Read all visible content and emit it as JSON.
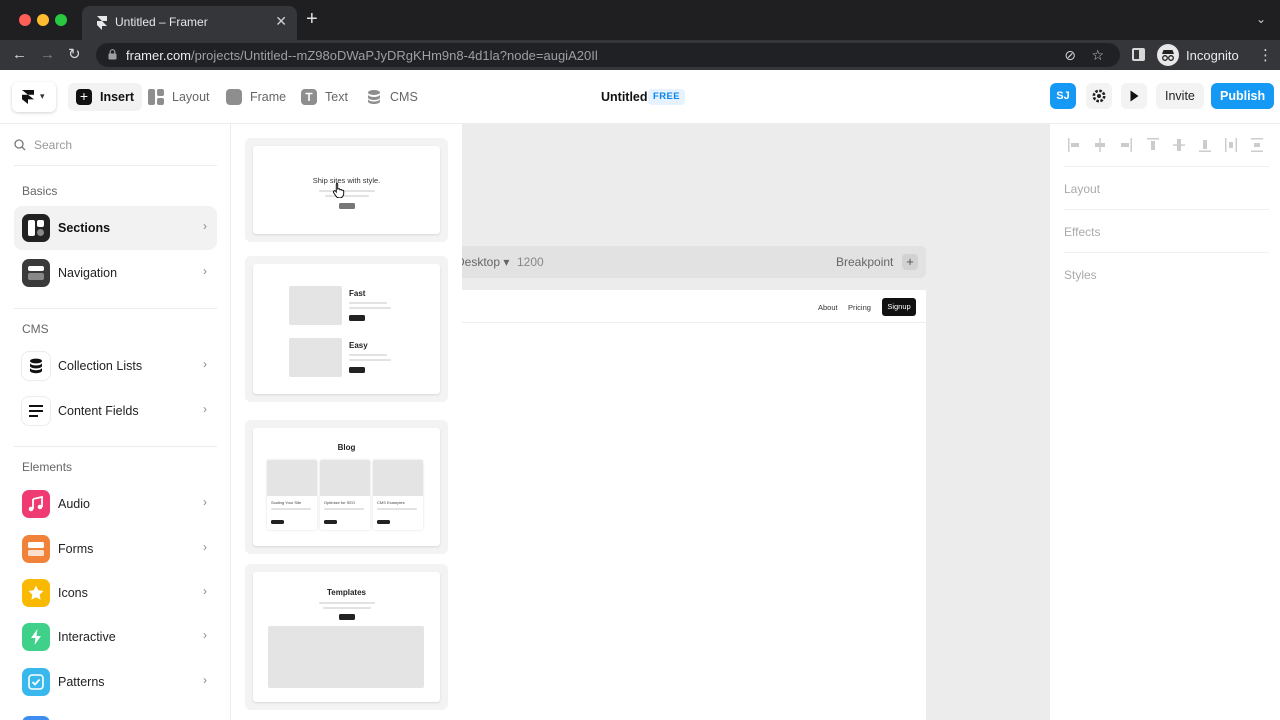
{
  "browser": {
    "tab_title": "Untitled – Framer",
    "url_domain": "framer.com",
    "url_path": "/projects/Untitled--mZ98oDWaPJyDRgKHm9n8-4d1la?node=augiA20Il",
    "profile_label": "Incognito"
  },
  "toolbar": {
    "insert": "Insert",
    "layout": "Layout",
    "frame": "Frame",
    "text": "Text",
    "cms": "CMS",
    "doc_title": "Untitled",
    "plan_badge": "FREE",
    "avatar_initials": "SJ",
    "invite": "Invite",
    "publish": "Publish"
  },
  "sidebar": {
    "search_placeholder": "Search",
    "groups": [
      {
        "title": "Basics",
        "items": [
          {
            "label": "Sections",
            "icon": "sections-icon",
            "color": "#222222"
          },
          {
            "label": "Navigation",
            "icon": "navigation-icon",
            "color": "#3a3a3a"
          }
        ]
      },
      {
        "title": "CMS",
        "items": [
          {
            "label": "Collection Lists",
            "icon": "database-icon",
            "color": "#ffffff"
          },
          {
            "label": "Content Fields",
            "icon": "lines-icon",
            "color": "#ffffff"
          }
        ]
      },
      {
        "title": "Elements",
        "items": [
          {
            "label": "Audio",
            "icon": "music-icon",
            "color": "#ef3a72"
          },
          {
            "label": "Forms",
            "icon": "form-icon",
            "color": "#f0823a"
          },
          {
            "label": "Icons",
            "icon": "star-icon",
            "color": "#f8b900"
          },
          {
            "label": "Interactive",
            "icon": "bolt-icon",
            "color": "#3fd18a"
          },
          {
            "label": "Patterns",
            "icon": "check-icon",
            "color": "#39b8ee"
          }
        ]
      }
    ]
  },
  "templates": {
    "hero": {
      "title": "Ship sites with style."
    },
    "features": {
      "items": [
        {
          "title": "Fast"
        },
        {
          "title": "Easy"
        }
      ]
    },
    "blog": {
      "title": "Blog",
      "cards": [
        {
          "title": "Scaling Your Site"
        },
        {
          "title": "Optimize for SEO"
        },
        {
          "title": "CMS Examples"
        }
      ]
    },
    "templates": {
      "title": "Templates"
    }
  },
  "canvas": {
    "breakpoint_name": "Desktop",
    "breakpoint_width": "1200",
    "breakpoint_label": "Breakpoint",
    "nav_links": [
      "About",
      "Pricing"
    ],
    "nav_cta": "Signup"
  },
  "properties": {
    "sections": [
      "Layout",
      "Effects",
      "Styles"
    ]
  },
  "colors": {
    "accent": "#1599f5",
    "canvas_bg": "#ececec"
  }
}
